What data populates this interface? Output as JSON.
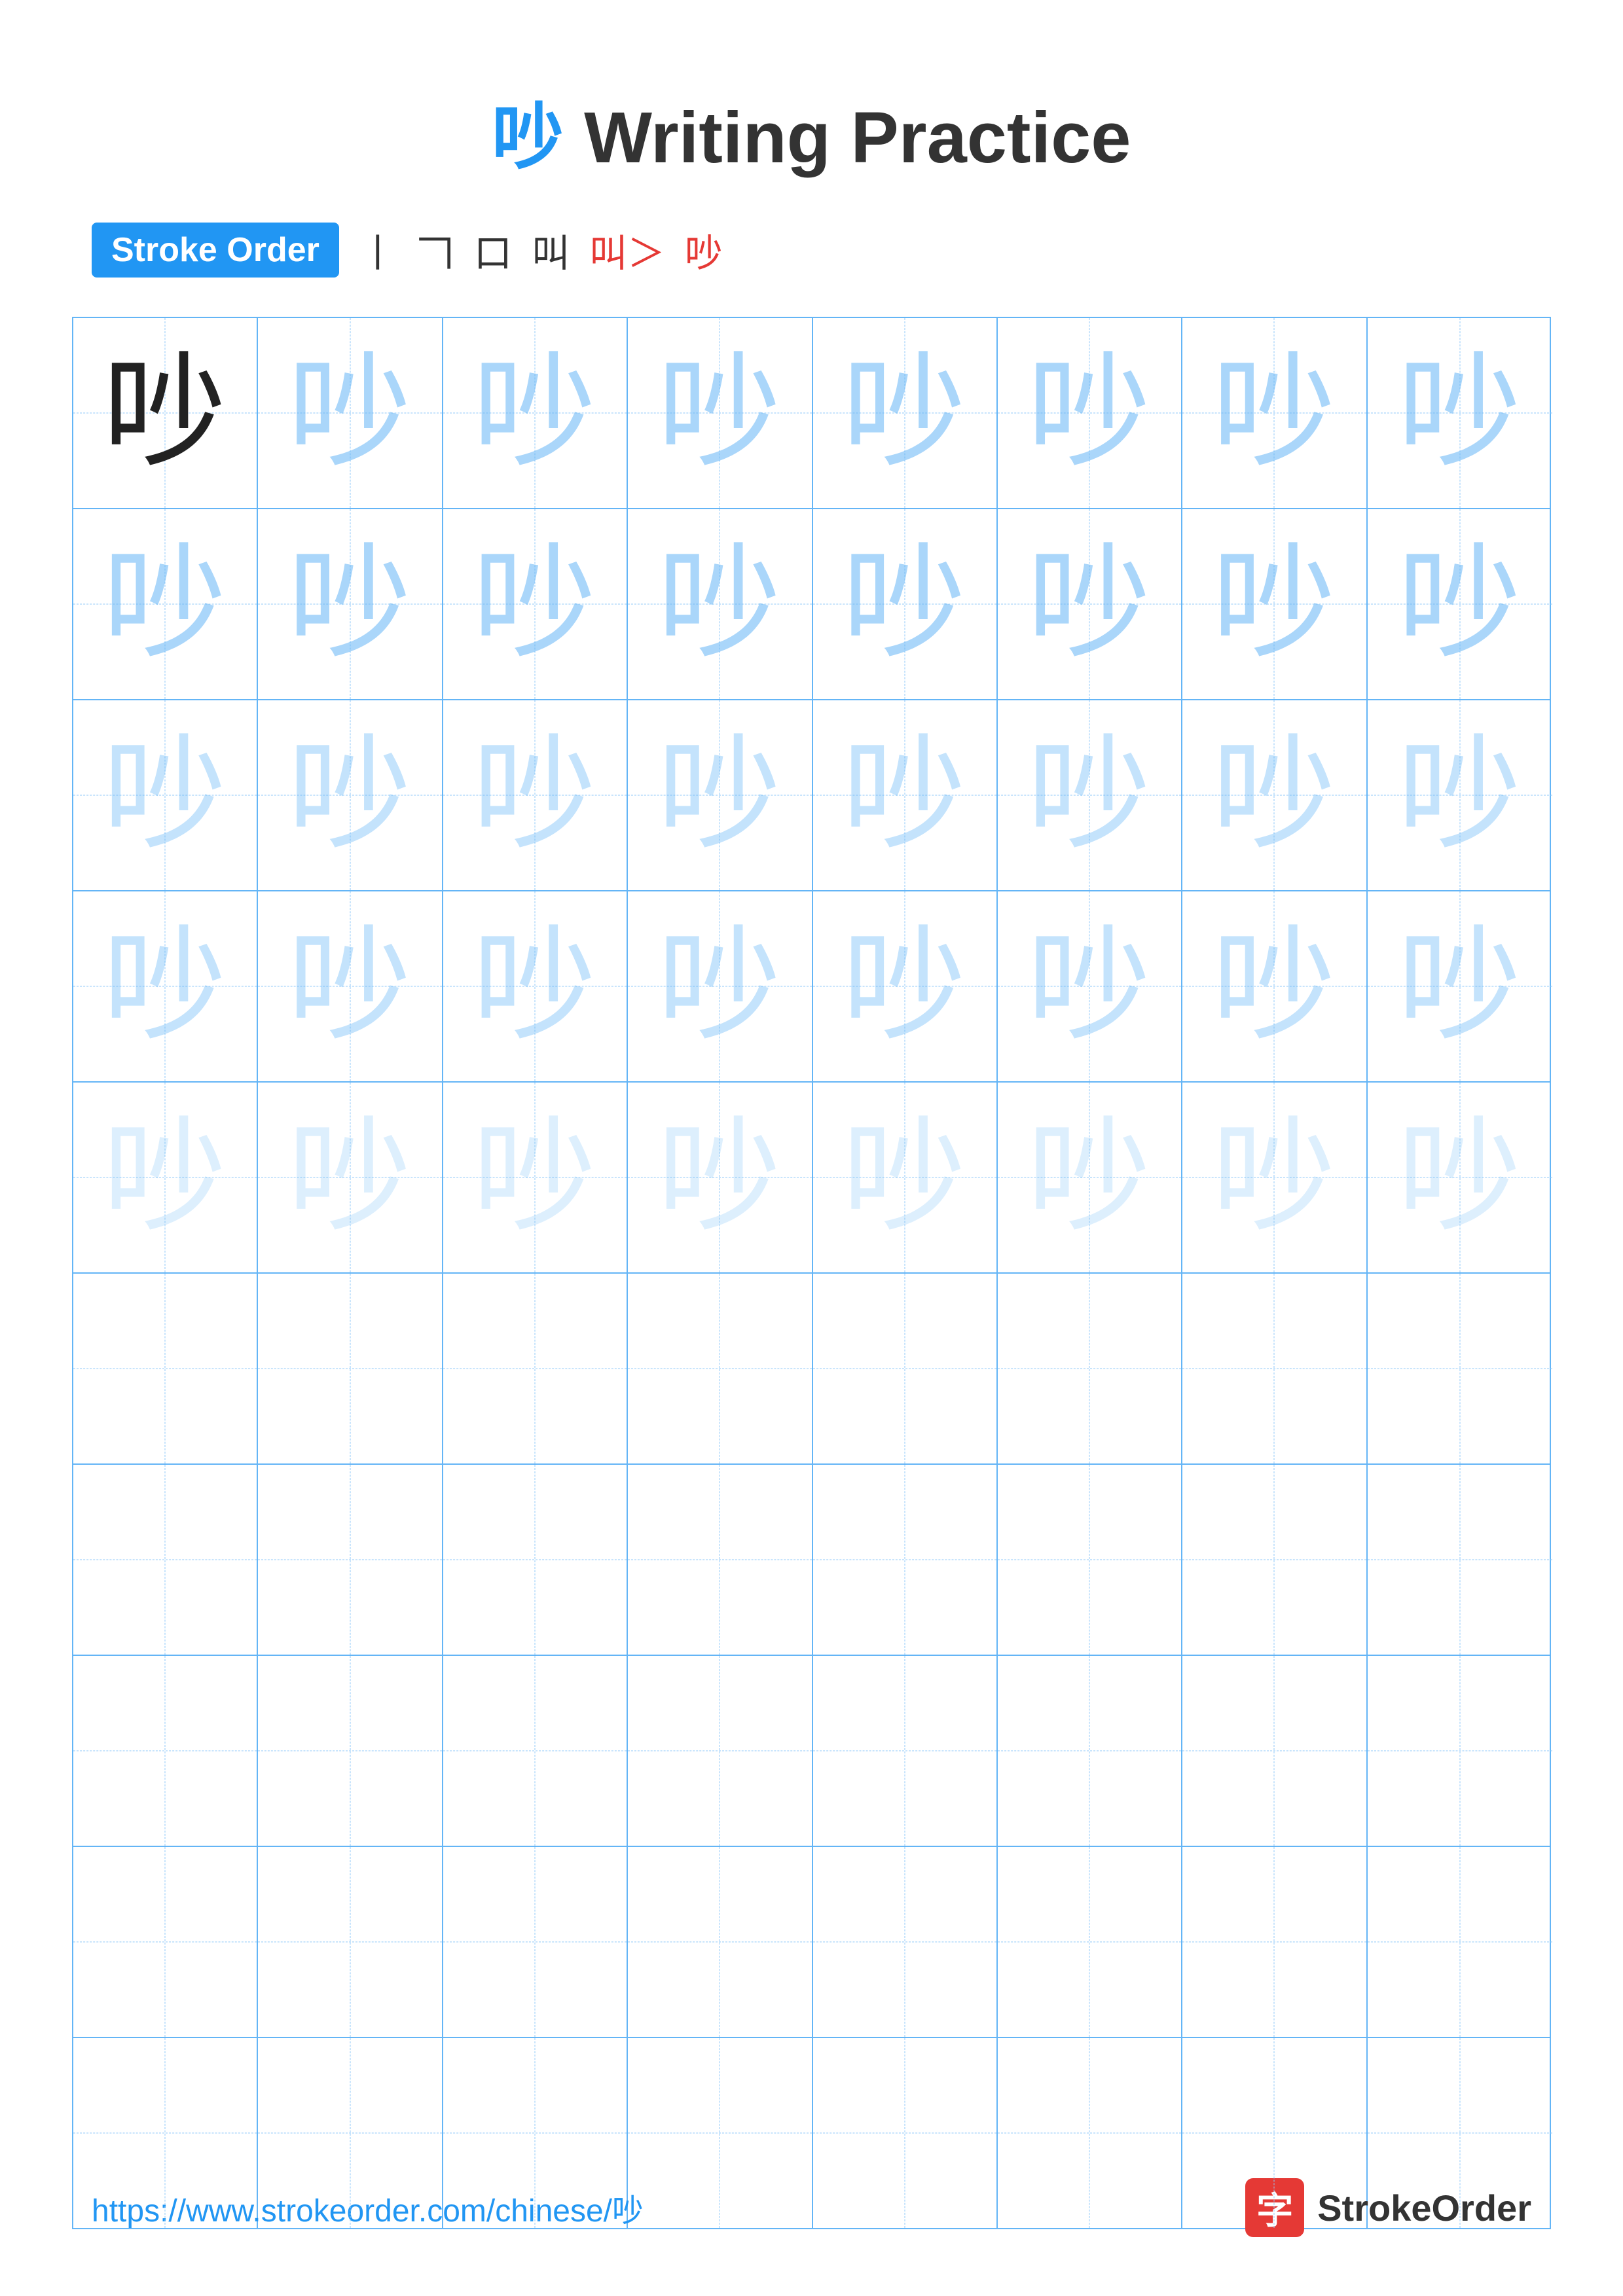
{
  "page": {
    "title": "Writing Practice",
    "char": "吵",
    "charColor": "#2196F3"
  },
  "strokeOrder": {
    "badge": "Stroke Order",
    "steps": [
      "丨",
      "𠃍",
      "口",
      "叫",
      "叫＞",
      "吵"
    ]
  },
  "grid": {
    "rows": 10,
    "cols": 8,
    "charFilled": 5,
    "char": "吵"
  },
  "footer": {
    "url": "https://www.strokeorder.com/chinese/吵",
    "brandIcon": "字",
    "brandName": "StrokeOrder"
  }
}
